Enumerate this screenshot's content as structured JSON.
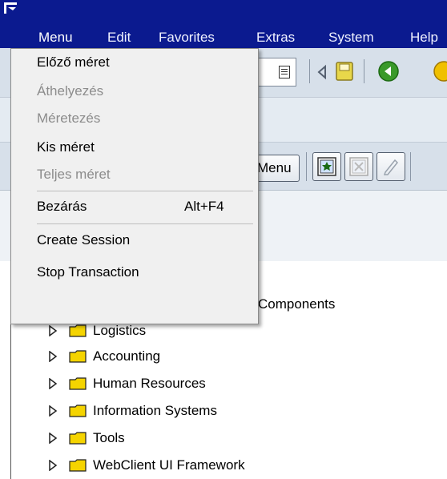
{
  "menubar": {
    "items": [
      {
        "label": "Menu",
        "active": true
      },
      {
        "label": "Edit"
      },
      {
        "label": "Favorites"
      },
      {
        "label": "Extras"
      },
      {
        "label": "System"
      },
      {
        "label": "Help"
      }
    ]
  },
  "toolbar": {
    "menu_button_label": "Menu"
  },
  "dropdown": {
    "items": [
      {
        "label": "Előző méret",
        "enabled": true
      },
      {
        "label": "Áthelyezés",
        "enabled": false
      },
      {
        "label": "Méretezés",
        "enabled": false
      },
      {
        "label": "Kis méret",
        "enabled": true
      },
      {
        "label": "Teljes méret",
        "enabled": false
      },
      {
        "label": "Bezárás",
        "shortcut": "Alt+F4",
        "enabled": true
      },
      {
        "label": "Create Session",
        "enabled": true
      },
      {
        "label": "Stop Transaction",
        "enabled": true
      }
    ]
  },
  "tree": {
    "root_label": "Components",
    "items": [
      {
        "label": "Logistics"
      },
      {
        "label": "Accounting"
      },
      {
        "label": "Human Resources"
      },
      {
        "label": "Information Systems"
      },
      {
        "label": "Tools"
      },
      {
        "label": "WebClient UI Framework"
      }
    ]
  },
  "colors": {
    "titlebar": "#0b1a8f",
    "toolbar": "#d7e0ea",
    "menu_bg": "#f0f0f0",
    "folder": "#f5d400",
    "disabled_text": "#8c8c8c"
  }
}
